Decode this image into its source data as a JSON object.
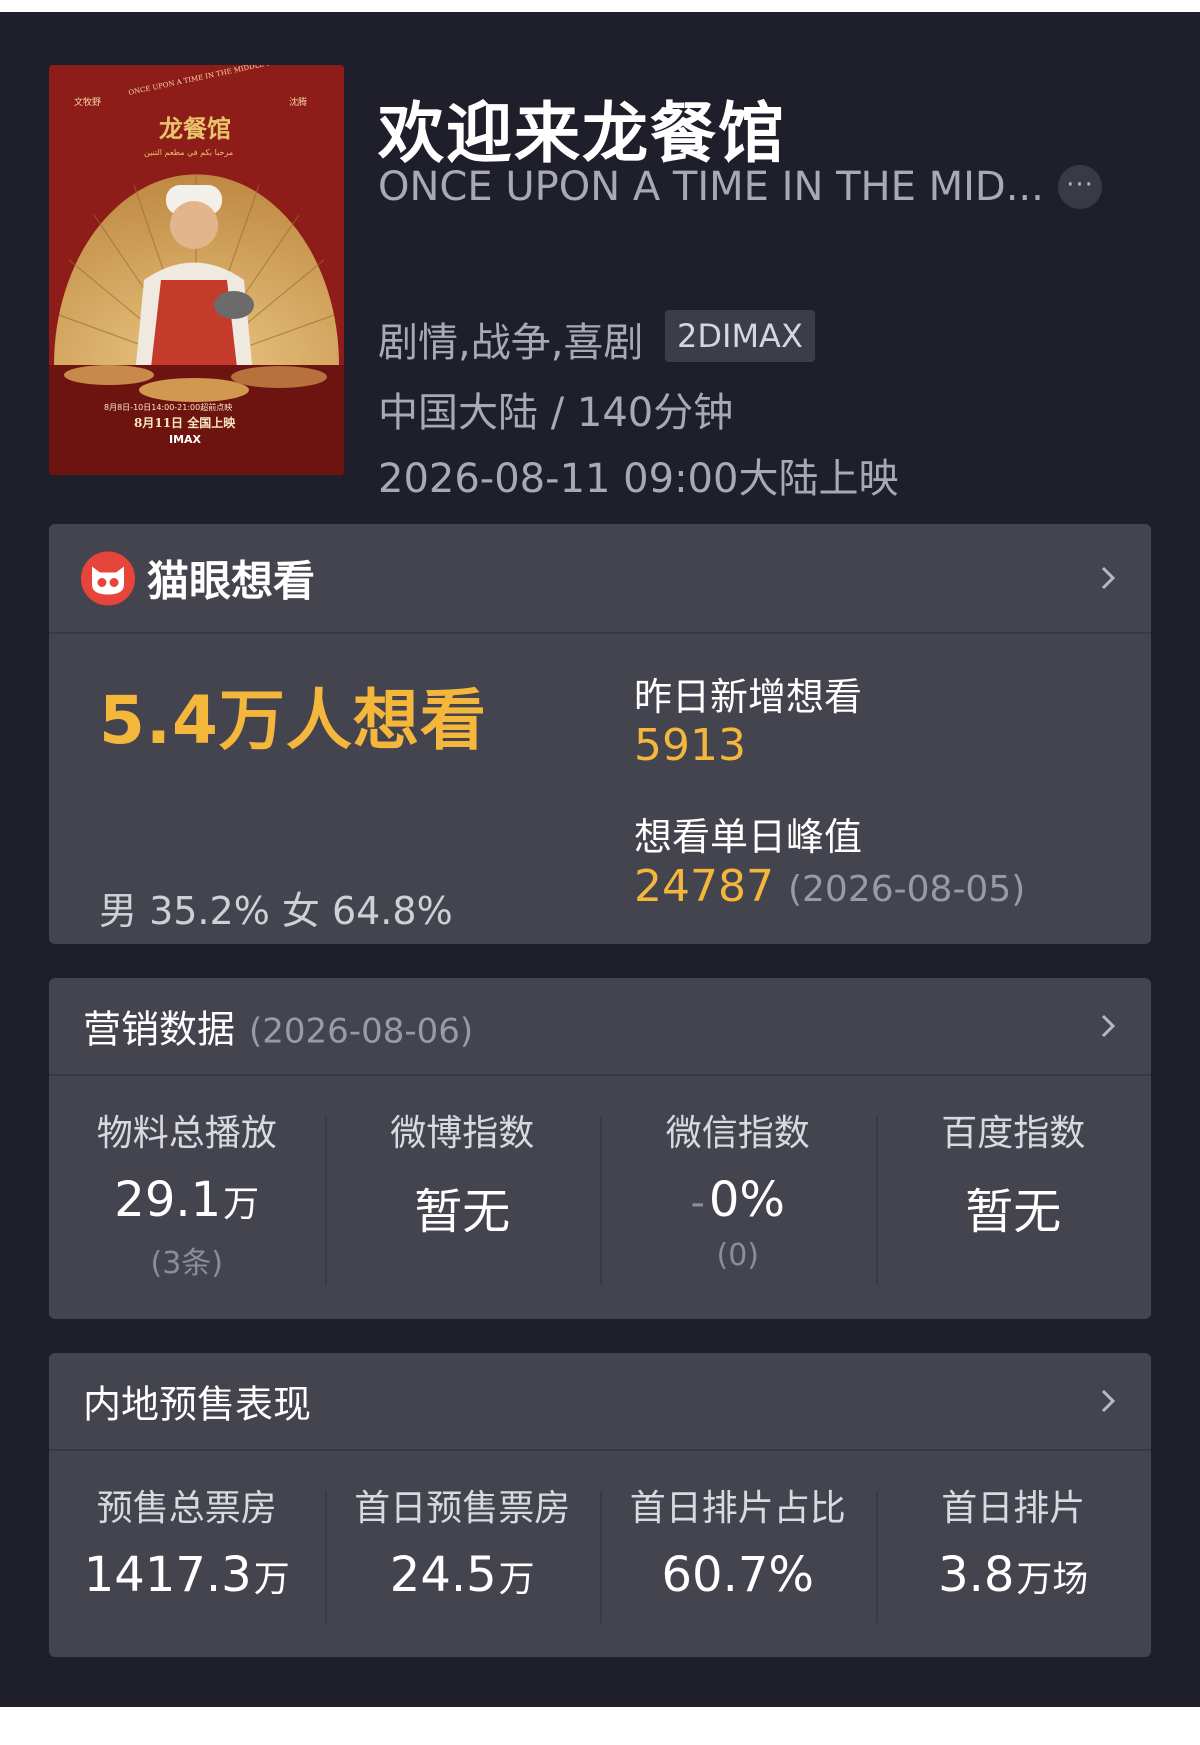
{
  "movie": {
    "title": "欢迎来龙餐馆",
    "subtitle": "ONCE UPON A TIME IN THE MID...",
    "more_icon": "ellipsis-icon",
    "genre": "剧情,战争,喜剧",
    "format_badge": "2DIMAX",
    "region_duration": "中国大陆 / 140分钟",
    "release": "2026-08-11 09:00大陆上映"
  },
  "poster": {
    "top_left_name": "文牧野",
    "top_right_name": "沈腾",
    "arc_text": "ONCE UPON A TIME IN THE MIDDLE EAST",
    "logo_text": "龙餐馆",
    "arabic_line": "مرحبا بكم في مطعم التنين",
    "screening_line": "8月8日-10日14:00-21:00超前点映",
    "release_line": "8月11日 全国上映",
    "imax": "IMAX",
    "colors": {
      "bg": "#8e1d1a",
      "fan": "#d9b062",
      "apron": "#c43a2b"
    }
  },
  "maoyan": {
    "brand": "猫眼想看",
    "brand_icon": "maoyan-cat-icon",
    "want_total": "5.4万人想看",
    "gender": "男 35.2% 女 64.8%",
    "new_label": "昨日新增想看",
    "new_value": "5913",
    "peak_label": "想看单日峰值",
    "peak_value": "24787",
    "peak_date": "(2026-08-05)"
  },
  "marketing": {
    "title": "营销数据",
    "date": "(2026-08-06)",
    "items": [
      {
        "label": "物料总播放",
        "value": "29.1",
        "unit": "万",
        "sub": "(3条)"
      },
      {
        "label": "微博指数",
        "value": "暂无",
        "unit": "",
        "sub": ""
      },
      {
        "label": "微信指数",
        "prefix": "-",
        "value": "0%",
        "unit": "",
        "sub": "(0)"
      },
      {
        "label": "百度指数",
        "value": "暂无",
        "unit": "",
        "sub": ""
      }
    ]
  },
  "presale": {
    "title": "内地预售表现",
    "items": [
      {
        "label": "预售总票房",
        "value": "1417.3",
        "unit": "万"
      },
      {
        "label": "首日预售票房",
        "value": "24.5",
        "unit": "万"
      },
      {
        "label": "首日排片占比",
        "value": "60.7%",
        "unit": ""
      },
      {
        "label": "首日排片",
        "value": "3.8",
        "unit": "万场"
      }
    ]
  },
  "colors": {
    "background": "#1f1f2b",
    "card": "#44444f",
    "accent": "#f4b63b",
    "brand_red": "#e8453a"
  }
}
